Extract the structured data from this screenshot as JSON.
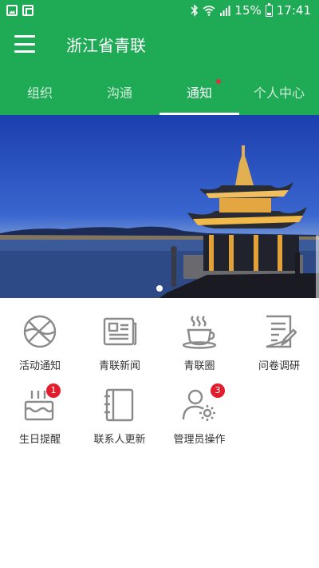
{
  "status_bar": {
    "battery": "15%",
    "time": "17:41"
  },
  "app": {
    "title": "浙江省青联"
  },
  "tabs": [
    {
      "label": "组织"
    },
    {
      "label": "沟通"
    },
    {
      "label": "通知"
    },
    {
      "label": "个人中心"
    }
  ],
  "grid": [
    {
      "label": "活动通知",
      "icon": "basketball-icon"
    },
    {
      "label": "青联新闻",
      "icon": "newspaper-icon"
    },
    {
      "label": "青联圈",
      "icon": "coffee-cup-icon"
    },
    {
      "label": "问卷调研",
      "icon": "survey-icon"
    },
    {
      "label": "生日提醒",
      "icon": "birthday-cake-icon",
      "badge": "1"
    },
    {
      "label": "联系人更新",
      "icon": "address-book-icon"
    },
    {
      "label": "管理员操作",
      "icon": "admin-gear-icon",
      "badge": "3"
    }
  ],
  "colors": {
    "primary": "#1faa55",
    "badge": "#e21e2d",
    "icon_gray": "#8a8a8a"
  }
}
